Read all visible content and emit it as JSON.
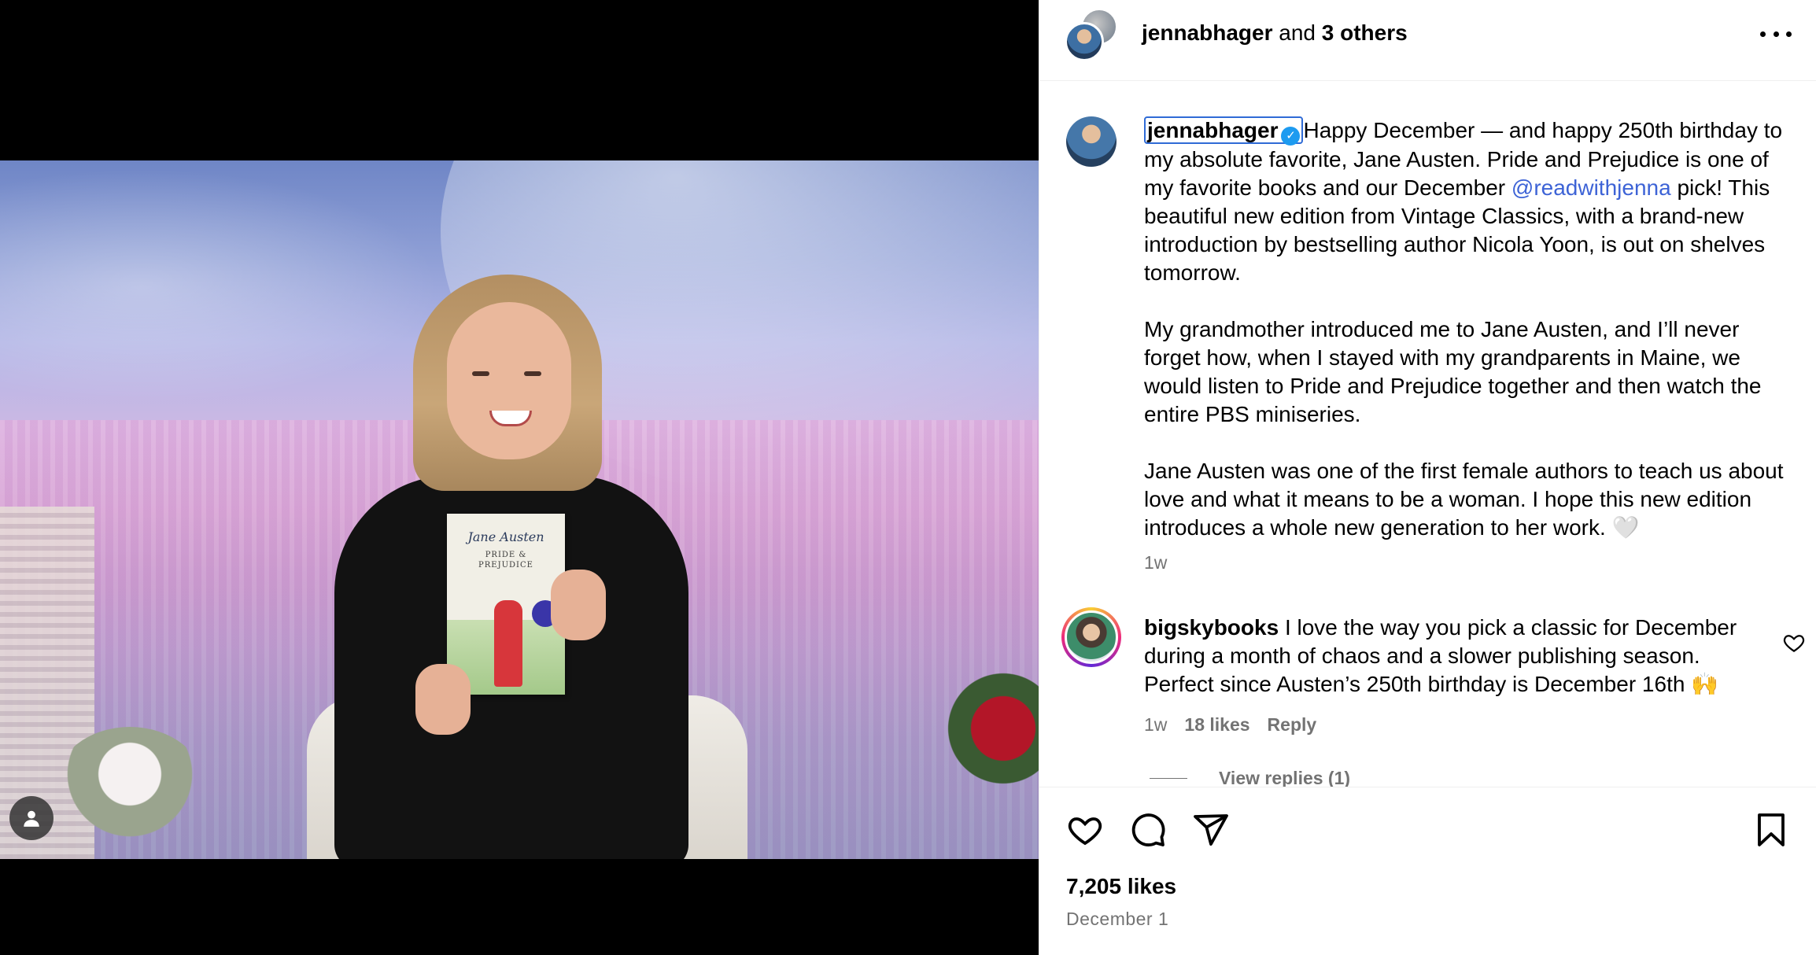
{
  "post": {
    "header": {
      "owner": "jennabhager",
      "and_text": "and",
      "others": "3 others"
    },
    "caption": {
      "username": "jennabhager",
      "text_1": "Happy December — and happy 250th birthday to my absolute favorite, Jane Austen. Pride and Prejudice is one of my favorite books and our December ",
      "mention": "@readwithjenna",
      "text_2": " pick! This beautiful new edition from Vintage Classics, with a brand-new introduction by bestselling author Nicola Yoon, is out on shelves tomorrow.",
      "paragraph_2": "My grandmother introduced me to Jane Austen, and I’ll never forget how, when I stayed with my grandparents in Maine, we would listen to Pride and Prejudice together and then watch the entire PBS miniseries.",
      "paragraph_3": "Jane Austen was one of the first female authors to teach us about love and what it means to be a woman. I hope this new edition introduces a whole new generation to her work.",
      "emoji": "🤍",
      "time": "1w"
    },
    "comment": {
      "username": "bigskybooks",
      "text": "I love the way you pick a classic for December during a month of chaos and a slower publishing season. Perfect since Austen’s 250th birthday is December 16th 🙌",
      "time": "1w",
      "likes": "18 likes",
      "reply": "Reply",
      "view_replies": "View replies (1)"
    },
    "likes": "7,205 likes",
    "date": "December 1"
  },
  "book": {
    "author": "Jane Austen",
    "title_line1": "PRIDE &",
    "title_line2": "PREJUDICE"
  },
  "icons": [
    "more-icon",
    "verified-icon",
    "heart-icon",
    "comment-icon",
    "share-icon",
    "bookmark-icon",
    "person-icon"
  ]
}
